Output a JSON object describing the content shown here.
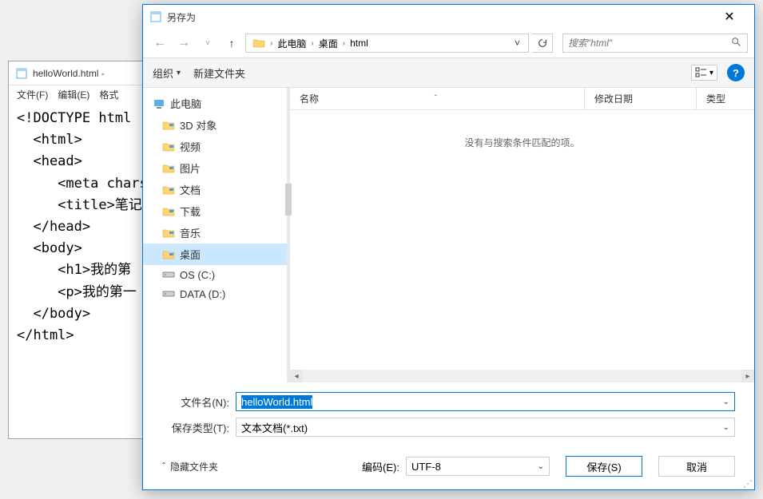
{
  "notepad": {
    "title": "helloWorld.html -",
    "menu": {
      "file": "文件(F)",
      "edit": "编辑(E)",
      "format": "格式"
    },
    "content": "<!DOCTYPE html\n  <html>\n  <head>\n     <meta charse\n     <title>笔记网\n  </head>\n  <body>\n     <h1>我的第\n     <p>我的第一\n  </body>\n</html>"
  },
  "dialog": {
    "title": "另存为",
    "breadcrumb": {
      "item1": "此电脑",
      "item2": "桌面",
      "item3": "html"
    },
    "search_placeholder": "搜索\"html\"",
    "toolbar": {
      "organize": "组织",
      "new_folder": "新建文件夹"
    },
    "columns": {
      "name": "名称",
      "date": "修改日期",
      "type": "类型"
    },
    "empty_message": "没有与搜索条件匹配的项。",
    "tree": {
      "root": "此电脑",
      "items": [
        "3D 对象",
        "视频",
        "图片",
        "文档",
        "下载",
        "音乐",
        "桌面",
        "OS (C:)",
        "DATA (D:)"
      ]
    },
    "form": {
      "filename_label": "文件名(N):",
      "filename_value": "helloWorld.html",
      "filetype_label": "保存类型(T):",
      "filetype_value": "文本文档(*.txt)",
      "hide_folders": "隐藏文件夹",
      "encoding_label": "编码(E):",
      "encoding_value": "UTF-8",
      "save_btn": "保存(S)",
      "cancel_btn": "取消"
    }
  }
}
